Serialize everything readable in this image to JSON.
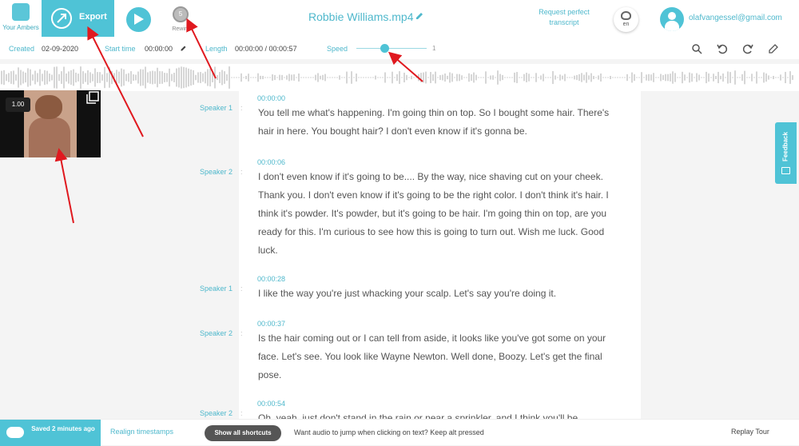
{
  "header": {
    "logo_label": "Your Ambers",
    "export_label": "Export",
    "rewind_seconds": "5",
    "rewind_label": "Rewind",
    "title": "Robbie Williams.mp4",
    "request_label": "Request perfect transcript",
    "lang_code": "en",
    "email": "olafvangessel@gmail.com"
  },
  "meta": {
    "created_label": "Created",
    "created_value": "02-09-2020",
    "start_label": "Start time",
    "start_value": "00:00:00",
    "length_label": "Length",
    "length_value": "00:00:00 / 00:00:57",
    "speed_label": "Speed",
    "speed_max": "1",
    "speed_fraction": 0.4
  },
  "video": {
    "rate": "1.00"
  },
  "transcript": {
    "segments": [
      {
        "speaker": "Speaker 1",
        "timestamp": "00:00:00",
        "text": "You tell me what's happening. I'm going thin on top. So I bought some hair. There's hair in here. You bought hair? I don't even know if it's gonna be."
      },
      {
        "speaker": "Speaker 2",
        "timestamp": "00:00:06",
        "text": "I don't even know if it's going to be.... By the way, nice shaving cut on your cheek. Thank you. I don't even know if it's going to be the right color. I don't think it's hair. I think it's powder. It's powder, but it's going to be hair. I'm going thin on top, are you ready for this. I'm curious to see how this is going to turn out. Wish me luck. Good luck."
      },
      {
        "speaker": "Speaker 1",
        "timestamp": "00:00:28",
        "text": "I like the way you're just whacking your scalp. Let's say you're doing it."
      },
      {
        "speaker": "Speaker 2",
        "timestamp": "00:00:37",
        "text": "Is the hair coming out or I can tell from aside, it looks like you've got some on your face. Let's see. You look like Wayne Newton. Well done, Boozy. Let's get the final pose."
      },
      {
        "speaker": "Speaker 2",
        "timestamp": "00:00:54",
        "text": "Oh, yeah, just don't stand in the rain or near a sprinkler, and I think you'll be"
      }
    ]
  },
  "feedback_label": "Feedback",
  "footer": {
    "saved_label": "Saved 2 minutes ago",
    "realign_label": "Realign timestamps",
    "shortcuts_label": "Show all shortcuts",
    "hint": "Want audio to jump when clicking on text? Keep alt pressed",
    "replay_label": "Replay Tour"
  },
  "colors": {
    "accent": "#4fc3d6",
    "annotation_arrow": "#e0191f"
  },
  "icons": [
    "logo-icon",
    "export-icon",
    "play-icon",
    "rewind-icon",
    "pencil-icon",
    "globe-icon",
    "avatar-icon",
    "search-icon",
    "undo-icon",
    "redo-icon",
    "edit-icon",
    "fullscreen-icon",
    "cloud-upload-icon",
    "feedback-icon"
  ]
}
